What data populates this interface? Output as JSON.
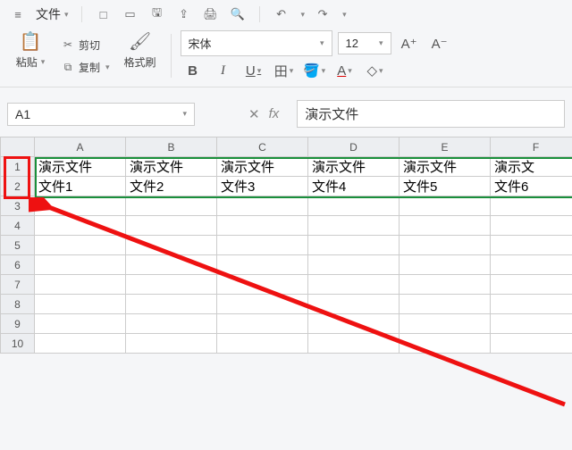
{
  "titlebar": {
    "file_menu": "文件",
    "icons": {
      "hamburger": "≡",
      "new": "□",
      "open": "▭",
      "save": "🖫",
      "export": "⇪",
      "print": "🖨",
      "preview": "🔍",
      "undo": "↶",
      "redo": "↷"
    }
  },
  "ribbon": {
    "paste": "粘贴",
    "cut": "剪切",
    "copy": "复制",
    "format_painter": "格式刷",
    "font_name": "宋体",
    "font_size": "12",
    "grow_font": "A⁺",
    "shrink_font": "A⁻"
  },
  "fxbar": {
    "namebox": "A1",
    "formula": "演示文件"
  },
  "sheet": {
    "cols": [
      "A",
      "B",
      "C",
      "D",
      "E",
      "F"
    ],
    "rows": [
      "1",
      "2",
      "3",
      "4",
      "5",
      "6",
      "7",
      "8",
      "9",
      "10"
    ],
    "data": {
      "r1": [
        "演示文件",
        "演示文件",
        "演示文件",
        "演示文件",
        "演示文件",
        "演示文"
      ],
      "r2": [
        "文件1",
        "文件2",
        "文件3",
        "文件4",
        "文件5",
        "文件6"
      ]
    }
  }
}
